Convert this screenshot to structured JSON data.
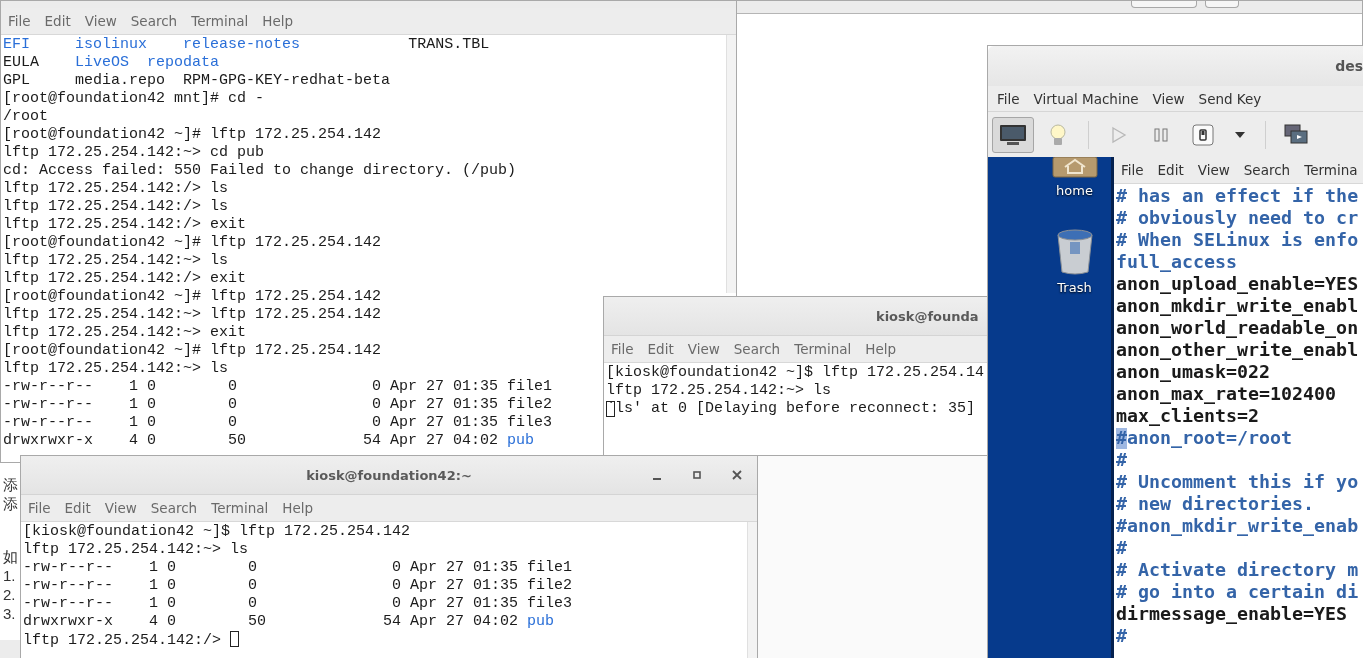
{
  "background_document": {
    "paragraphs": [
      [
        "添",
        "添"
      ],
      [
        "如",
        "1.",
        "2.",
        "3."
      ]
    ]
  },
  "terminals": [
    {
      "menu": [
        "File",
        "Edit",
        "View",
        "Search",
        "Terminal",
        "Help"
      ],
      "lines": [
        {
          "segments": [
            {
              "text": "EFI     ",
              "kind": "dir"
            },
            {
              "text": "isolinux    ",
              "kind": "dir"
            },
            {
              "text": "release-notes            ",
              "kind": "dir"
            },
            {
              "text": "TRANS.TBL",
              "kind": "plain"
            }
          ]
        },
        {
          "segments": [
            {
              "text": "EULA    ",
              "kind": "plain"
            },
            {
              "text": "LiveOS  ",
              "kind": "dir"
            },
            {
              "text": "repodata",
              "kind": "dir"
            }
          ]
        },
        {
          "text": "GPL     media.repo  RPM-GPG-KEY-redhat-beta"
        },
        {
          "text": "[root@foundation42 mnt]# cd -"
        },
        {
          "text": "/root"
        },
        {
          "text": "[root@foundation42 ~]# lftp 172.25.254.142"
        },
        {
          "text": "lftp 172.25.254.142:~> cd pub"
        },
        {
          "text": "cd: Access failed: 550 Failed to change directory. (/pub)"
        },
        {
          "text": "lftp 172.25.254.142:/> ls"
        },
        {
          "text": "lftp 172.25.254.142:/> ls"
        },
        {
          "text": "lftp 172.25.254.142:/> exit"
        },
        {
          "text": "[root@foundation42 ~]# lftp 172.25.254.142"
        },
        {
          "text": "lftp 172.25.254.142:~> ls"
        },
        {
          "text": "lftp 172.25.254.142:/> exit"
        },
        {
          "text": "[root@foundation42 ~]# lftp 172.25.254.142"
        },
        {
          "text": "lftp 172.25.254.142:~> lftp 172.25.254.142"
        },
        {
          "text": "lftp 172.25.254.142:~> exit"
        },
        {
          "text": "[root@foundation42 ~]# lftp 172.25.254.142"
        },
        {
          "text": "lftp 172.25.254.142:~> ls"
        },
        {
          "text": "-rw-r--r--    1 0        0               0 Apr 27 01:35 file1"
        },
        {
          "text": "-rw-r--r--    1 0        0               0 Apr 27 01:35 file2"
        },
        {
          "text": "-rw-r--r--    1 0        0               0 Apr 27 01:35 file3"
        },
        {
          "segments": [
            {
              "text": "drwxrwxr-x    4 0        50             54 Apr 27 04:02 ",
              "kind": "plain"
            },
            {
              "text": "pub",
              "kind": "dir"
            }
          ]
        }
      ]
    },
    {
      "title": "kiosk@founda",
      "menu": [
        "File",
        "Edit",
        "View",
        "Search",
        "Terminal",
        "Help"
      ],
      "lines": [
        {
          "text": "[kiosk@foundation42 ~]$ lftp 172.25.254.14"
        },
        {
          "text": "lftp 172.25.254.142:~> ls"
        },
        {
          "text": "`ls' at 0 [Delaying before reconnect: 35]",
          "cursor_on_first": true
        }
      ]
    },
    {
      "title": "kiosk@foundation42:~",
      "menu": [
        "File",
        "Edit",
        "View",
        "Search",
        "Terminal",
        "Help"
      ],
      "lines": [
        {
          "text": "[kiosk@foundation42 ~]$ lftp 172.25.254.142"
        },
        {
          "text": "lftp 172.25.254.142:~> ls"
        },
        {
          "text": "-rw-r--r--    1 0        0               0 Apr 27 01:35 file1"
        },
        {
          "text": "-rw-r--r--    1 0        0               0 Apr 27 01:35 file2"
        },
        {
          "text": "-rw-r--r--    1 0        0               0 Apr 27 01:35 file3"
        },
        {
          "segments": [
            {
              "text": "drwxrwxr-x    4 0        50             54 Apr 27 04:02 ",
              "kind": "plain"
            },
            {
              "text": "pub",
              "kind": "dir"
            }
          ]
        },
        {
          "text": "lftp 172.25.254.142:/> ",
          "cursor_after": true
        }
      ]
    }
  ],
  "vm_window": {
    "title": "des",
    "menu": [
      "File",
      "Virtual Machine",
      "View",
      "Send Key"
    ],
    "toolbar": [
      {
        "kind": "console",
        "selected": true
      },
      {
        "kind": "details",
        "selected": false
      },
      {
        "kind": "separator"
      },
      {
        "kind": "run",
        "disabled": true
      },
      {
        "kind": "pause",
        "disabled": false
      },
      {
        "kind": "power"
      },
      {
        "kind": "dropdown",
        "disabled": false
      },
      {
        "kind": "separator"
      },
      {
        "kind": "screens"
      }
    ],
    "desktop_icons": [
      {
        "label": "home",
        "kind": "home"
      },
      {
        "label": "Trash",
        "kind": "trash"
      }
    ],
    "guest_terminal": {
      "menu": [
        "File",
        "Edit",
        "View",
        "Search",
        "Termina"
      ],
      "lines": [
        {
          "text": "# has an effect if the",
          "kind": "comment"
        },
        {
          "text": "# obviously need to cr",
          "kind": "comment"
        },
        {
          "text": "# When SELinux is enfo",
          "kind": "comment"
        },
        {
          "text": "full_access",
          "kind": "comment"
        },
        {
          "text": "anon_upload_enable=YES",
          "kind": "setting"
        },
        {
          "text": "anon_mkdir_write_enabl",
          "kind": "setting"
        },
        {
          "text": "anon_world_readable_on",
          "kind": "setting"
        },
        {
          "text": "anon_other_write_enabl",
          "kind": "setting"
        },
        {
          "text": "anon_umask=022",
          "kind": "setting"
        },
        {
          "text": "anon_max_rate=102400",
          "kind": "setting"
        },
        {
          "text": "max_clients=2",
          "kind": "setting"
        },
        {
          "text": "#anon_root=/root",
          "kind": "comment",
          "cursor_on_first": true
        },
        {
          "text": "#",
          "kind": "comment"
        },
        {
          "text": "# Uncomment this if yo",
          "kind": "comment"
        },
        {
          "text": "# new directories.",
          "kind": "comment"
        },
        {
          "text": "#anon_mkdir_write_enab",
          "kind": "comment"
        },
        {
          "text": "#",
          "kind": "comment"
        },
        {
          "text": "# Activate directory m",
          "kind": "comment"
        },
        {
          "text": "# go into a certain di",
          "kind": "comment"
        },
        {
          "text": "dirmessage_enable=YES",
          "kind": "setting"
        },
        {
          "text": "#",
          "kind": "comment"
        }
      ]
    }
  }
}
